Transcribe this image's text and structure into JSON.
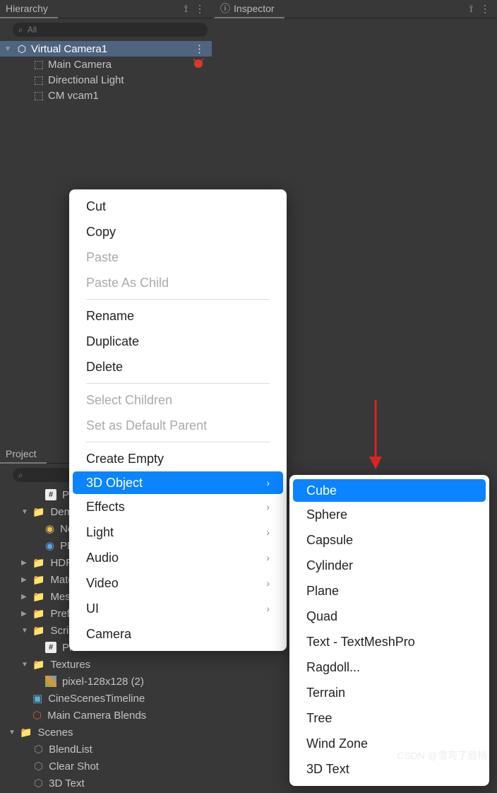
{
  "panels": {
    "hierarchy": {
      "title": "Hierarchy"
    },
    "inspector": {
      "title": "Inspector"
    },
    "project": {
      "title": "Project"
    }
  },
  "search": {
    "placeholder_all": "All",
    "placeholder_empty": ""
  },
  "hierarchy": {
    "scene": "Virtual Camera1",
    "items": [
      "Main Camera",
      "Directional Light",
      "CM vcam1"
    ]
  },
  "project": {
    "items": [
      {
        "label": "Pla",
        "depth": 2,
        "icon": "script"
      },
      {
        "label": "Demo",
        "depth": 1,
        "icon": "folder",
        "open": true
      },
      {
        "label": "Nev",
        "depth": 2,
        "icon": "prefab-y"
      },
      {
        "label": "PP\\",
        "depth": 2,
        "icon": "prefab-b"
      },
      {
        "label": "HDRP",
        "depth": 1,
        "icon": "folder"
      },
      {
        "label": "Mater",
        "depth": 1,
        "icon": "folder"
      },
      {
        "label": "Mesh",
        "depth": 1,
        "icon": "folder"
      },
      {
        "label": "Prefa",
        "depth": 1,
        "icon": "folder"
      },
      {
        "label": "Script",
        "depth": 1,
        "icon": "folder",
        "open": true
      },
      {
        "label": "Pla",
        "depth": 2,
        "icon": "script"
      },
      {
        "label": "Textures",
        "depth": 1,
        "icon": "folder",
        "open": true
      },
      {
        "label": "pixel-128x128 (2)",
        "depth": 2,
        "icon": "image"
      },
      {
        "label": "CineScenesTimeline",
        "depth": 1,
        "icon": "timeline"
      },
      {
        "label": "Main Camera Blends",
        "depth": 1,
        "icon": "blend"
      }
    ],
    "scenes_header": "Scenes",
    "scenes": [
      "BlendList",
      "Clear Shot",
      "3D Text"
    ]
  },
  "context_menu": {
    "items": [
      {
        "label": "Cut"
      },
      {
        "label": "Copy"
      },
      {
        "label": "Paste",
        "disabled": true
      },
      {
        "label": "Paste As Child",
        "disabled": true
      },
      {
        "sep": true
      },
      {
        "label": "Rename"
      },
      {
        "label": "Duplicate"
      },
      {
        "label": "Delete"
      },
      {
        "sep": true
      },
      {
        "label": "Select Children",
        "disabled": true
      },
      {
        "label": "Set as Default Parent",
        "disabled": true
      },
      {
        "sep": true
      },
      {
        "label": "Create Empty"
      },
      {
        "label": "3D Object",
        "sub": true,
        "highlight": true
      },
      {
        "label": "Effects",
        "sub": true
      },
      {
        "label": "Light",
        "sub": true
      },
      {
        "label": "Audio",
        "sub": true
      },
      {
        "label": "Video",
        "sub": true
      },
      {
        "label": "UI",
        "sub": true
      },
      {
        "label": "Camera"
      }
    ],
    "submenu": [
      {
        "label": "Cube",
        "highlight": true
      },
      {
        "label": "Sphere"
      },
      {
        "label": "Capsule"
      },
      {
        "label": "Cylinder"
      },
      {
        "label": "Plane"
      },
      {
        "label": "Quad"
      },
      {
        "label": "Text - TextMeshPro"
      },
      {
        "label": "Ragdoll..."
      },
      {
        "label": "Terrain"
      },
      {
        "label": "Tree"
      },
      {
        "label": "Wind Zone"
      },
      {
        "label": "3D Text"
      }
    ]
  },
  "watermark": "CSDN @雪弯了眉梢"
}
